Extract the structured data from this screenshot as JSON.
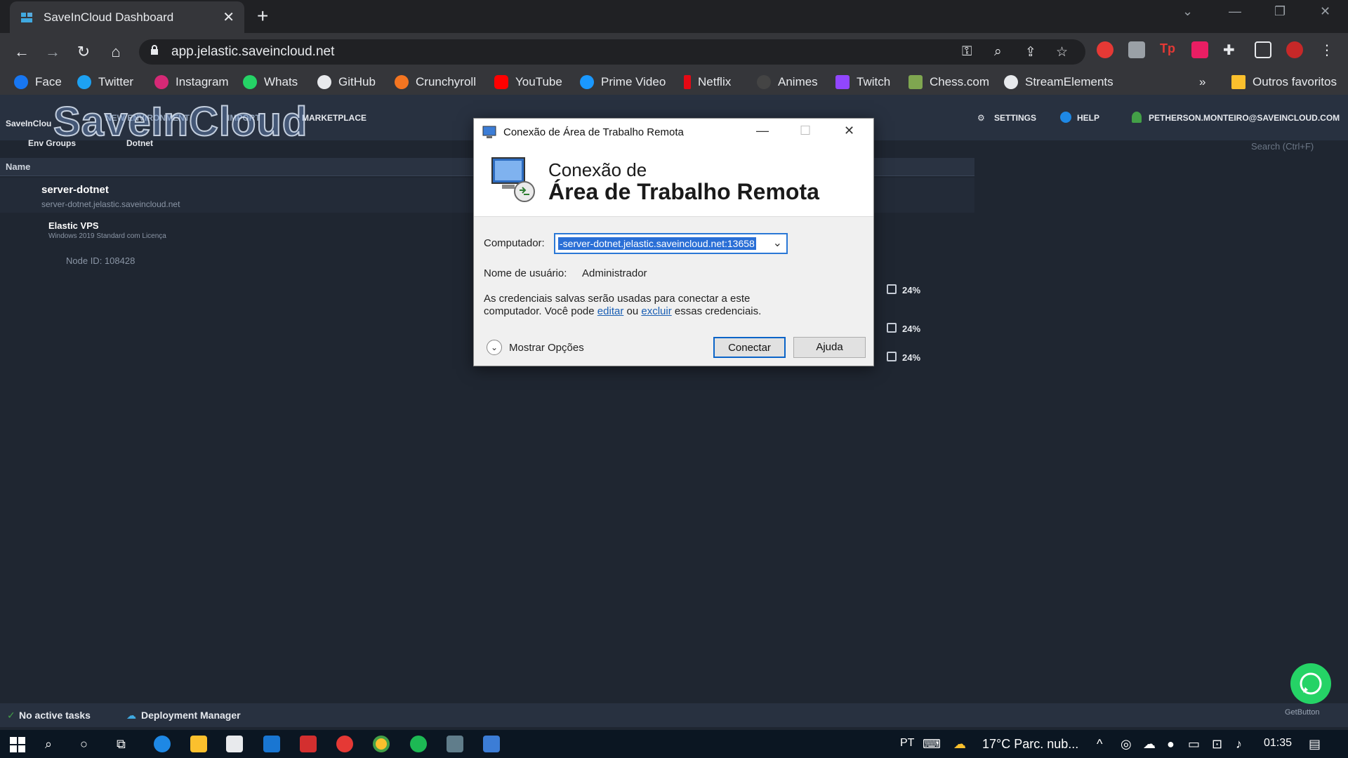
{
  "browser": {
    "tab_title": "SaveInCloud Dashboard",
    "url": "app.jelastic.saveincloud.net",
    "bookmarks": [
      "Face",
      "Twitter",
      "Instagram",
      "Whats",
      "GitHub",
      "Crunchyroll",
      "YouTube",
      "Prime Video",
      "Netflix",
      "Animes",
      "Twitch",
      "Chess.com",
      "StreamElements"
    ],
    "other_favorites": "Outros favoritos"
  },
  "app": {
    "logo": "SaveInCloud",
    "logo_small": "SaveInClou",
    "nav": {
      "new_env": "NEW ENVIRONMENT",
      "import": "IMPORT",
      "marketplace": "MARKETPLACE",
      "settings": "SETTINGS",
      "help": "HELP",
      "user": "PETHERSON.MONTEIRO@SAVEINCLOUD.COM"
    },
    "subnav": {
      "env_groups": "Env Groups",
      "dotnet": "Dotnet"
    },
    "search_placeholder": "Search (Ctrl+F)",
    "column_name": "Name",
    "env": {
      "name": "server-dotnet",
      "domain": "server-dotnet.jelastic.saveincloud.net",
      "node_group": "Elastic VPS",
      "node_group_sub": "Windows 2019 Standard com Licença",
      "node": "Node ID: 108428",
      "usage": [
        "24%",
        "24%",
        "24%"
      ]
    },
    "status": {
      "tasks": "No active tasks",
      "deploy": "Deployment Manager"
    },
    "getbutton": "GetButton"
  },
  "dialog": {
    "title": "Conexão de Área de Trabalho Remota",
    "banner_line1": "Conexão de",
    "banner_line2": "Área de Trabalho Remota",
    "computer_label": "Computador:",
    "computer_value": "-server-dotnet.jelastic.saveincloud.net:13658",
    "user_label": "Nome de usuário:",
    "user_value": "Administrador",
    "cred_text_1": "As credenciais salvas serão usadas para conectar a este",
    "cred_text_2a": "computador. Você pode",
    "cred_edit": "editar",
    "cred_or": "ou",
    "cred_delete": "excluir",
    "cred_text_2b": "essas credenciais.",
    "show_options": "Mostrar Opções",
    "connect": "Conectar",
    "help": "Ajuda"
  },
  "taskbar": {
    "lang": "PT",
    "weather": "17°C  Parc. nub...",
    "time": "01:35"
  }
}
